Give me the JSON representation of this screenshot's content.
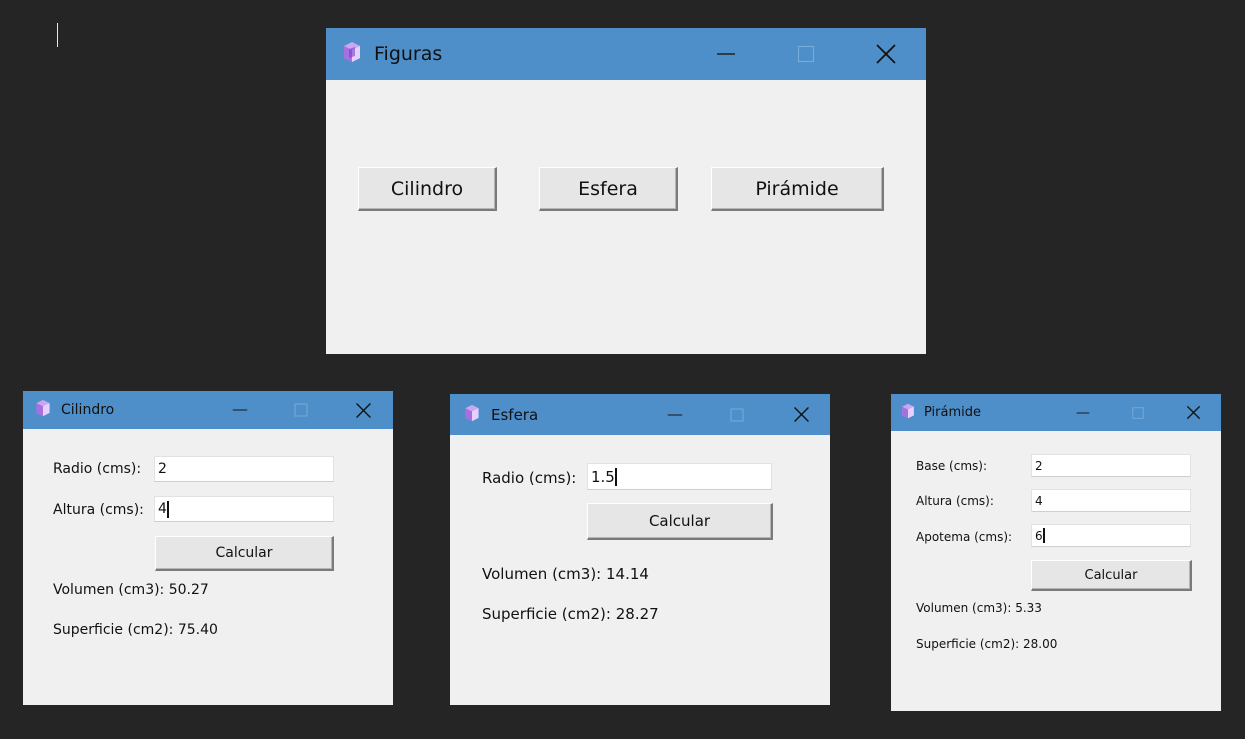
{
  "main": {
    "title": "Figuras",
    "buttons": {
      "cilindro": "Cilindro",
      "esfera": "Esfera",
      "piramide": "Pirámide"
    }
  },
  "cilindro": {
    "title": "Cilindro",
    "radio_label": "Radio (cms):",
    "radio_value": "2",
    "altura_label": "Altura (cms):",
    "altura_value": "4",
    "calcular": "Calcular",
    "volumen": "Volumen (cm3): 50.27",
    "superficie": "Superficie (cm2): 75.40"
  },
  "esfera": {
    "title": "Esfera",
    "radio_label": "Radio (cms):",
    "radio_value": "1.5",
    "calcular": "Calcular",
    "volumen": "Volumen (cm3): 14.14",
    "superficie": "Superficie (cm2): 28.27"
  },
  "piramide": {
    "title": "Pirámide",
    "base_label": "Base (cms):",
    "base_value": "2",
    "altura_label": "Altura (cms):",
    "altura_value": "4",
    "apotema_label": "Apotema (cms):",
    "apotema_value": "6",
    "calcular": "Calcular",
    "volumen": "Volumen (cm3): 5.33",
    "superficie": "Superficie (cm2): 28.00"
  },
  "icons": {
    "app": "tk-feather-icon",
    "minimize": "minimize-icon",
    "maximize": "maximize-icon",
    "close": "close-icon"
  },
  "colors": {
    "titlebar": "#4e8ec9",
    "window_bg": "#f0f0f0",
    "desktop_bg": "#252525"
  }
}
